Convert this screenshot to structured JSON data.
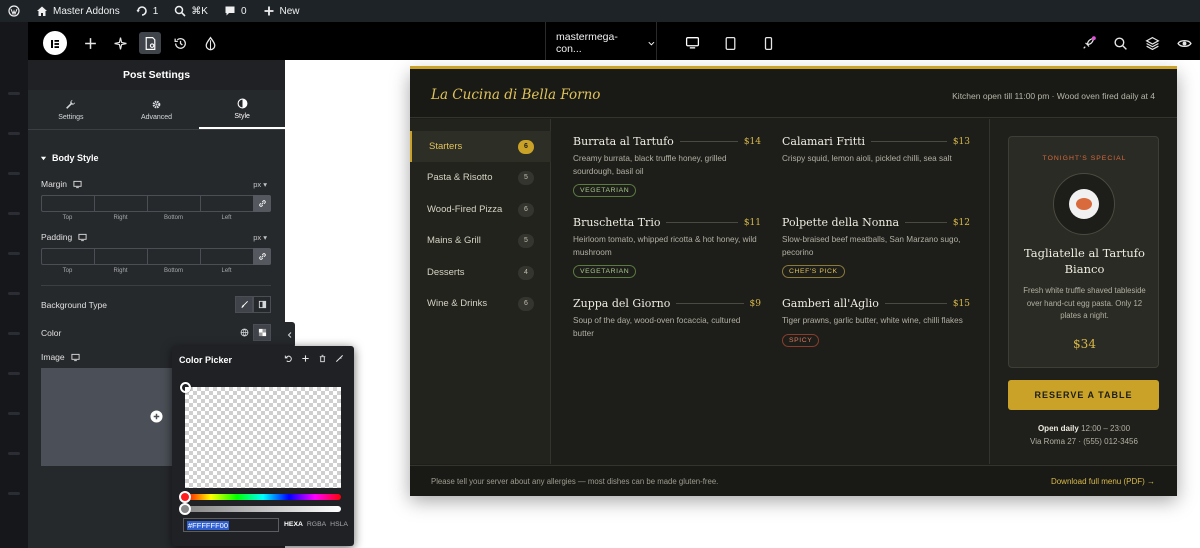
{
  "adminbar": {
    "site_name": "Master Addons",
    "updates_count": "1",
    "search_shortcut": "⌘K",
    "comments_count": "0",
    "new_label": "New"
  },
  "topbar": {
    "page_name": "mastermega-con...",
    "devices": [
      "desktop",
      "tablet",
      "mobile"
    ]
  },
  "panel": {
    "title": "Post Settings",
    "tabs": [
      {
        "label": "Settings",
        "icon": "wrench-icon"
      },
      {
        "label": "Advanced",
        "icon": "gear-icon"
      },
      {
        "label": "Style",
        "icon": "half-circle-icon",
        "active": true
      }
    ],
    "section_title": "Body Style",
    "margin_label": "Margin",
    "padding_label": "Padding",
    "unit": "px",
    "dim_labels": [
      "Top",
      "Right",
      "Bottom",
      "Left"
    ],
    "background_type_label": "Background Type",
    "color_label": "Color",
    "image_label": "Image"
  },
  "color_picker": {
    "title": "Color Picker",
    "hex_value": "#FFFFFF00",
    "modes": [
      "HEXA",
      "RGBA",
      "HSLA"
    ]
  },
  "menu": {
    "restaurant_name": "La Cucina di Bella Forno",
    "hours_note": "Kitchen open till 11:00 pm · Wood oven fired daily at 4",
    "categories": [
      {
        "name": "Starters",
        "count": "6"
      },
      {
        "name": "Pasta & Risotto",
        "count": "5"
      },
      {
        "name": "Wood-Fired Pizza",
        "count": "6"
      },
      {
        "name": "Mains & Grill",
        "count": "5"
      },
      {
        "name": "Desserts",
        "count": "4"
      },
      {
        "name": "Wine & Drinks",
        "count": "6"
      }
    ],
    "dishes": [
      {
        "name": "Burrata al Tartufo",
        "price": "$14",
        "desc": "Creamy burrata, black truffle honey, grilled sourdough, basil oil",
        "tag": "VEGETARIAN"
      },
      {
        "name": "Calamari Fritti",
        "price": "$13",
        "desc": "Crispy squid, lemon aioli, pickled chilli, sea salt",
        "tag": ""
      },
      {
        "name": "Bruschetta Trio",
        "price": "$11",
        "desc": "Heirloom tomato, whipped ricotta & hot honey, wild mushroom",
        "tag": "VEGETARIAN"
      },
      {
        "name": "Polpette della Nonna",
        "price": "$12",
        "desc": "Slow-braised beef meatballs, San Marzano sugo, pecorino",
        "tag": "CHEF'S PICK"
      },
      {
        "name": "Zuppa del Giorno",
        "price": "$9",
        "desc": "Soup of the day, wood-oven focaccia, cultured butter",
        "tag": ""
      },
      {
        "name": "Gamberi all'Aglio",
        "price": "$15",
        "desc": "Tiger prawns, garlic butter, white wine, chilli flakes",
        "tag": "SPICY"
      }
    ],
    "special": {
      "label": "TONIGHT'S SPECIAL",
      "name": "Tagliatelle al Tartufo Bianco",
      "desc": "Fresh white truffle shaved tableside over hand-cut egg pasta. Only 12 plates a night.",
      "price": "$34"
    },
    "reserve_label": "RESERVE A TABLE",
    "open_daily_label": "Open daily",
    "open_daily_hours": "12:00 – 23:00",
    "address": "Via Roma 27 · (555) 012-3456",
    "allergy_note": "Please tell your server about any allergies — most dishes can be made gluten-free.",
    "download_label": "Download full menu (PDF) →"
  },
  "colors": {
    "accent_gold": "#c9a227",
    "menu_bg": "#1d1e1a",
    "panel_bg": "#26292c",
    "topbar_bg": "#000000"
  }
}
